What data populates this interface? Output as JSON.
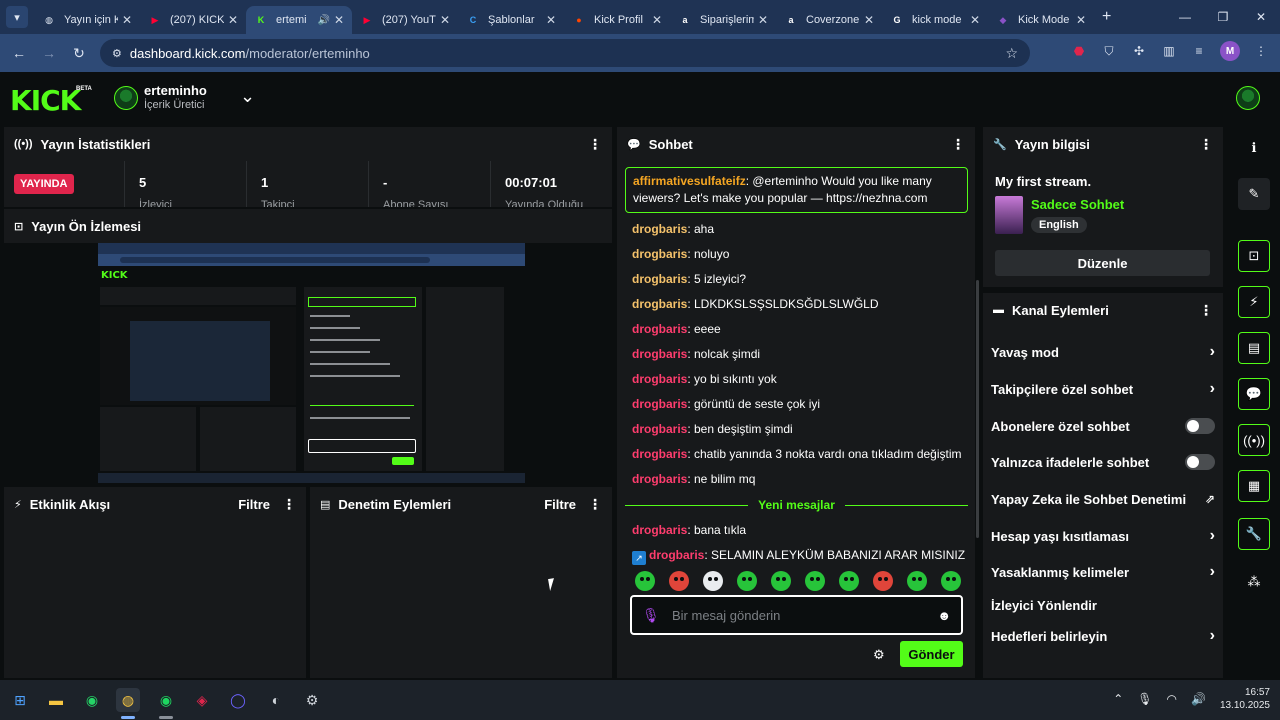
{
  "browser": {
    "tabs": [
      {
        "title": "Yayın için K",
        "favicon": "globe-icon",
        "color": "#dfe6f2"
      },
      {
        "title": "(207) KICK",
        "favicon": "youtube-icon",
        "color": "#ff0033"
      },
      {
        "title": "ertemi",
        "favicon": "kick-icon",
        "color": "#53fc18",
        "active": true,
        "audio": true
      },
      {
        "title": "(207) YouT",
        "favicon": "youtube-icon",
        "color": "#ff0033"
      },
      {
        "title": "Şablonlar",
        "favicon": "canva-icon",
        "color": "#3aa0f5"
      },
      {
        "title": "Kick Profil",
        "favicon": "reddit-icon",
        "color": "#ff4500"
      },
      {
        "title": "Siparişlerim",
        "favicon": "amazon-icon",
        "color": "#ffffff"
      },
      {
        "title": "Coverzone",
        "favicon": "amazon-icon",
        "color": "#ffffff"
      },
      {
        "title": "kick mode",
        "favicon": "google-icon",
        "color": "#ffffff"
      },
      {
        "title": "Kick Mode",
        "favicon": "gem-icon",
        "color": "#8a52c7"
      }
    ],
    "url_host": "dashboard.kick.com",
    "url_path": "/moderator/erteminho",
    "profile_initial": "M"
  },
  "header": {
    "logo": "KICK",
    "beta": "BETA",
    "channel_name": "erteminho",
    "channel_role": "İçerik Üretici"
  },
  "stats": {
    "title": "Yayın İstatistikleri",
    "live_label": "YAYINDA",
    "items": [
      {
        "value": "5",
        "label": "İzleyici"
      },
      {
        "value": "1",
        "label": "Takipçi"
      },
      {
        "value": "-",
        "label": "Abone Sayısı"
      },
      {
        "value": "00:07:01",
        "label": "Yayında Olduğu"
      }
    ]
  },
  "preview": {
    "title": "Yayın Ön İzlemesi"
  },
  "activity": {
    "title": "Etkinlik Akışı",
    "filter": "Filtre"
  },
  "moderation": {
    "title": "Denetim Eylemleri",
    "filter": "Filtre"
  },
  "chat": {
    "title": "Sohbet",
    "pinned": {
      "user": "affirmativesulfateifz",
      "text": ": @erteminho Would you like many viewers? Let's make you popular — https://nezhna.com"
    },
    "messages": [
      {
        "user": "drogbaris",
        "text": ": aha",
        "color": "gold"
      },
      {
        "user": "drogbaris",
        "text": ": noluyo",
        "color": "gold"
      },
      {
        "user": "drogbaris",
        "text": ": 5 izleyici?",
        "color": "gold"
      },
      {
        "user": "drogbaris",
        "text": ": LDKDKSLSŞSLDKSĞDLSLWĞLD",
        "color": "gold"
      },
      {
        "user": "drogbaris",
        "text": ": eeee",
        "color": "pink"
      },
      {
        "user": "drogbaris",
        "text": ": nolcak şimdi",
        "color": "pink"
      },
      {
        "user": "drogbaris",
        "text": ": yo bi sıkıntı yok",
        "color": "pink"
      },
      {
        "user": "drogbaris",
        "text": ": görüntü de seste çok iyi",
        "color": "pink"
      },
      {
        "user": "drogbaris",
        "text": ": ben deşiştim şimdi",
        "color": "pink"
      },
      {
        "user": "drogbaris",
        "text": ": chatib yanında 3 nokta vardı ona tıkladım değiştim",
        "color": "pink"
      },
      {
        "user": "drogbaris",
        "text": ": ne bilim mq",
        "color": "pink"
      }
    ],
    "new_messages_label": "Yeni mesajlar",
    "new_messages": [
      {
        "user": "drogbaris",
        "text": ": bana tıkla",
        "color": "pink"
      },
      {
        "user": "drogbaris",
        "text": ": SELAMIN ALEYKÜM BABANIZI ARAR MISINIZ",
        "color": "pink",
        "badge": true
      }
    ],
    "input_placeholder": "Bir mesaj gönderin",
    "send_label": "Gönder"
  },
  "stream_info": {
    "title": "Yayın bilgisi",
    "stream_title": "My first stream.",
    "category": "Sadece Sohbet",
    "language": "English",
    "edit_label": "Düzenle"
  },
  "channel_actions": {
    "title": "Kanal Eylemleri",
    "items": [
      {
        "label": "Yavaş mod",
        "control": "chevron"
      },
      {
        "label": "Takipçilere özel sohbet",
        "control": "chevron"
      },
      {
        "label": "Abonelere özel sohbet",
        "control": "toggle",
        "on": false
      },
      {
        "label": "Yalnızca ifadelerle sohbet",
        "control": "toggle",
        "on": false
      },
      {
        "label": "Yapay Zeka ile Sohbet Denetimi",
        "control": "external"
      },
      {
        "label": "Hesap yaşı kısıtlaması",
        "control": "chevron"
      },
      {
        "label": "Yasaklanmış kelimeler",
        "control": "chevron"
      },
      {
        "label": "İzleyici Yönlendir",
        "control": "none"
      },
      {
        "label": "Hedefleri belirleyin",
        "control": "chevron"
      }
    ]
  },
  "taskbar": {
    "time": "16:57",
    "date": "13.10.2025"
  }
}
